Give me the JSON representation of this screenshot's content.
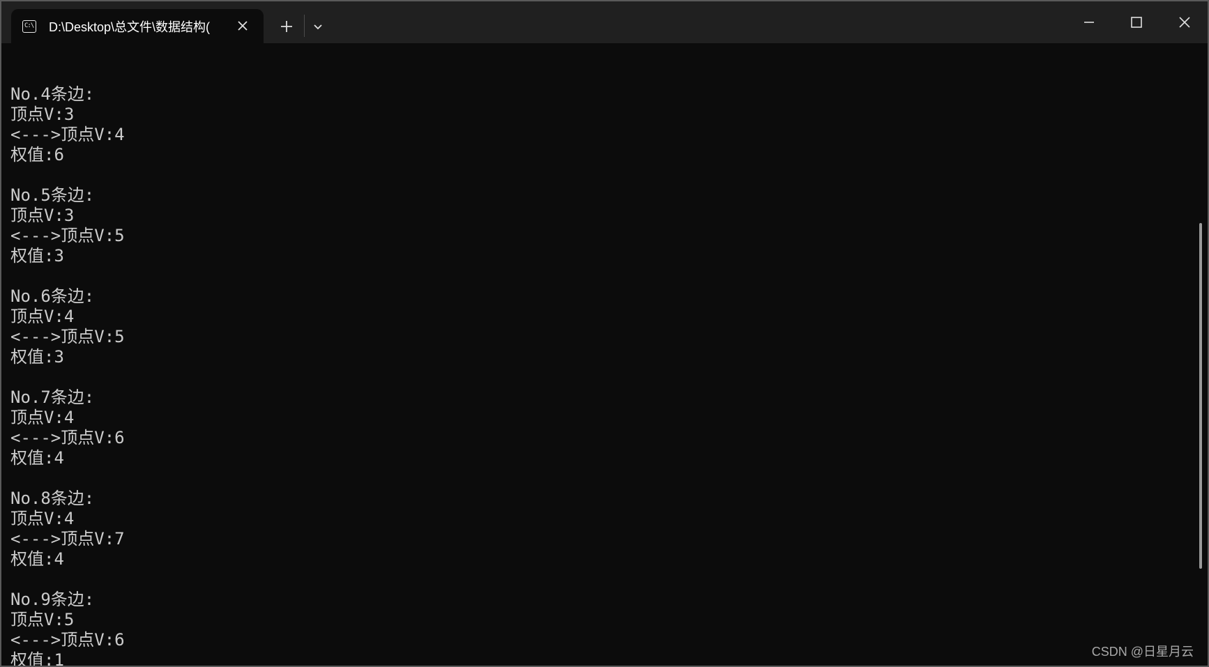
{
  "window": {
    "tab_title": "D:\\Desktop\\总文件\\数据结构(",
    "tab_icon_text": "C:\\",
    "icons": {
      "tab_icon": "console-icon",
      "close_tab": "close-icon",
      "new_tab": "plus-icon",
      "dropdown": "chevron-down-icon",
      "minimize": "minimize-icon",
      "maximize": "maximize-icon",
      "close_window": "close-icon"
    }
  },
  "console": {
    "lines": [
      "",
      "No.4条边:",
      "顶点V:3",
      "<--->顶点V:4",
      "权值:6",
      "",
      "No.5条边:",
      "顶点V:3",
      "<--->顶点V:5",
      "权值:3",
      "",
      "No.6条边:",
      "顶点V:4",
      "<--->顶点V:5",
      "权值:3",
      "",
      "No.7条边:",
      "顶点V:4",
      "<--->顶点V:6",
      "权值:4",
      "",
      "No.8条边:",
      "顶点V:4",
      "<--->顶点V:7",
      "权值:4",
      "",
      "No.9条边:",
      "顶点V:5",
      "<--->顶点V:6",
      "权值:1"
    ]
  },
  "watermark": "CSDN @日星月云",
  "colors": {
    "background": "#0c0c0c",
    "titlebar": "#202020",
    "text": "#cccccc"
  }
}
